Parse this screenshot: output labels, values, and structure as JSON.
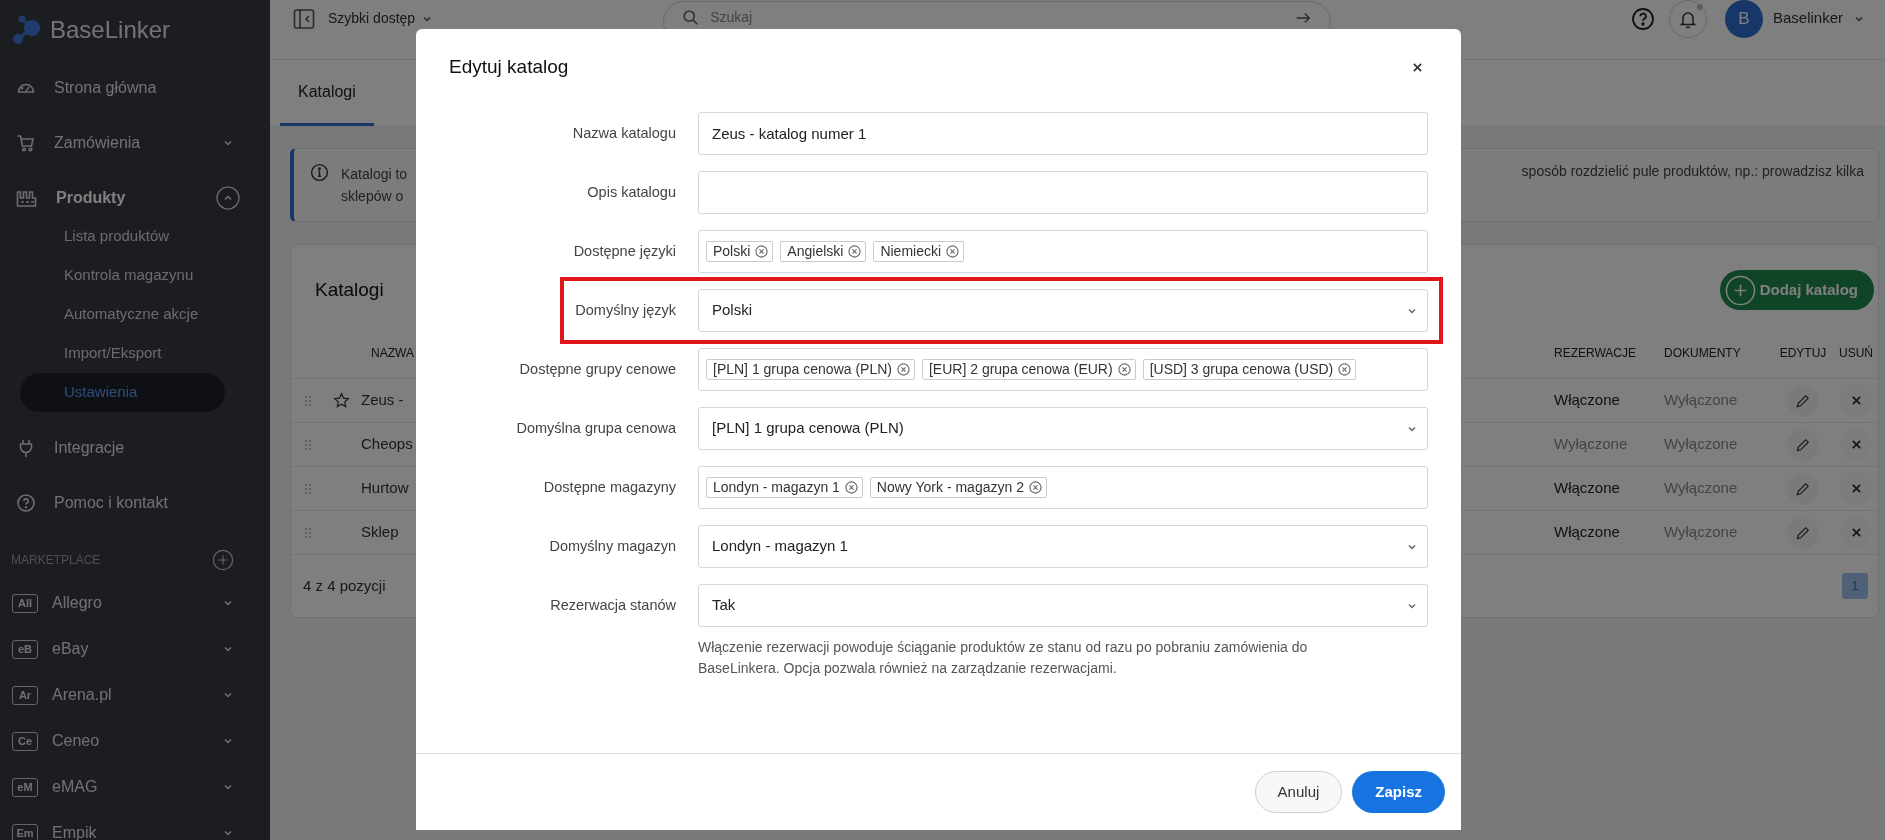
{
  "sidebar": {
    "logo": "BaseLinker",
    "items": [
      {
        "label": "Strona główna",
        "kind": "link"
      },
      {
        "label": "Zamówienia",
        "kind": "group",
        "expanded": false
      },
      {
        "label": "Produkty",
        "kind": "group",
        "expanded": true,
        "children": [
          {
            "label": "Lista produktów",
            "selected": false
          },
          {
            "label": "Kontrola magazynu",
            "selected": false
          },
          {
            "label": "Automatyczne akcje",
            "selected": false
          },
          {
            "label": "Import/Eksport",
            "selected": false
          },
          {
            "label": "Ustawienia",
            "selected": true
          }
        ]
      },
      {
        "label": "Integracje",
        "kind": "link"
      },
      {
        "label": "Pomoc i kontakt",
        "kind": "link"
      }
    ],
    "marketplace": {
      "title": "MARKETPLACE",
      "items": [
        {
          "badge": "All",
          "label": "Allegro"
        },
        {
          "badge": "eB",
          "label": "eBay"
        },
        {
          "badge": "Ar",
          "label": "Arena.pl"
        },
        {
          "badge": "Ce",
          "label": "Ceneo"
        },
        {
          "badge": "eM",
          "label": "eMAG"
        },
        {
          "badge": "Em",
          "label": "Empik"
        }
      ]
    }
  },
  "topbar": {
    "quick_access": "Szybki dostęp",
    "search_placeholder": "Szukaj",
    "notifications_unread": true,
    "avatar": "B",
    "user": "Baselinker"
  },
  "tabs": [
    {
      "label": "Katalogi",
      "selected": true
    }
  ],
  "info": {
    "left_lines": [
      "Katalogi to",
      "sklepów o"
    ],
    "right_text": "sposób rozdzielić pule produktów, np.: prowadzisz kilka"
  },
  "catalogs": {
    "title": "Katalogi",
    "add_button": "Dodaj katalog",
    "columns": {
      "name": "NAZWA",
      "reservations": "REZERWACJE",
      "documents": "DOKUMENTY",
      "edit": "EDYTUJ",
      "delete": "USUŃ"
    },
    "rows": [
      {
        "name": "Zeus -",
        "default": true,
        "reservations": "Włączone",
        "reservations_on": true,
        "documents": "Wyłączone",
        "documents_on": false
      },
      {
        "name": "Cheops",
        "default": false,
        "reservations": "Wyłączone",
        "reservations_on": false,
        "documents": "Wyłączone",
        "documents_on": false
      },
      {
        "name": "Hurtow",
        "default": false,
        "reservations": "Włączone",
        "reservations_on": true,
        "documents": "Wyłączone",
        "documents_on": false
      },
      {
        "name": "Sklep",
        "default": false,
        "reservations": "Włączone",
        "reservations_on": true,
        "documents": "Wyłączone",
        "documents_on": false
      }
    ],
    "footer": "4 z 4 pozycji",
    "pages": [
      {
        "label": "1",
        "selected": true
      }
    ]
  },
  "modal": {
    "title": "Edytuj katalog",
    "fields": [
      {
        "label": "Nazwa katalogu",
        "kind": "text",
        "value": "Zeus - katalog numer 1",
        "highlighted": false
      },
      {
        "label": "Opis katalogu",
        "kind": "text",
        "highlighted": false
      },
      {
        "label": "Dostępne języki",
        "kind": "tags",
        "tags": [
          "Polski",
          "Angielski",
          "Niemiecki"
        ],
        "highlighted": false
      },
      {
        "label": "Domyślny język",
        "kind": "select",
        "value": "Polski",
        "highlighted": true
      },
      {
        "label": "Dostępne grupy cenowe",
        "kind": "tags",
        "tags": [
          "[PLN] 1 grupa cenowa (PLN)",
          "[EUR] 2 grupa cenowa (EUR)",
          "[USD] 3 grupa cenowa (USD)"
        ],
        "highlighted": false
      },
      {
        "label": "Domyślna grupa cenowa",
        "kind": "select",
        "value": "[PLN] 1 grupa cenowa (PLN)",
        "highlighted": false
      },
      {
        "label": "Dostępne magazyny",
        "kind": "tags",
        "tags": [
          "Londyn - magazyn 1",
          "Nowy York - magazyn 2"
        ],
        "highlighted": false
      },
      {
        "label": "Domyślny magazyn",
        "kind": "select",
        "value": "Londyn - magazyn 1",
        "highlighted": false
      },
      {
        "label": "Rezerwacja stanów",
        "kind": "select",
        "value": "Tak",
        "highlighted": false,
        "hint": "Włączenie rezerwacji powoduje ściąganie produktów ze stanu od razu po pobraniu zamówienia do BaseLinkera. Opcja pozwala również na zarządzanie rezerwacjami."
      }
    ],
    "cancel": "Anuluj",
    "save": "Zapisz"
  }
}
